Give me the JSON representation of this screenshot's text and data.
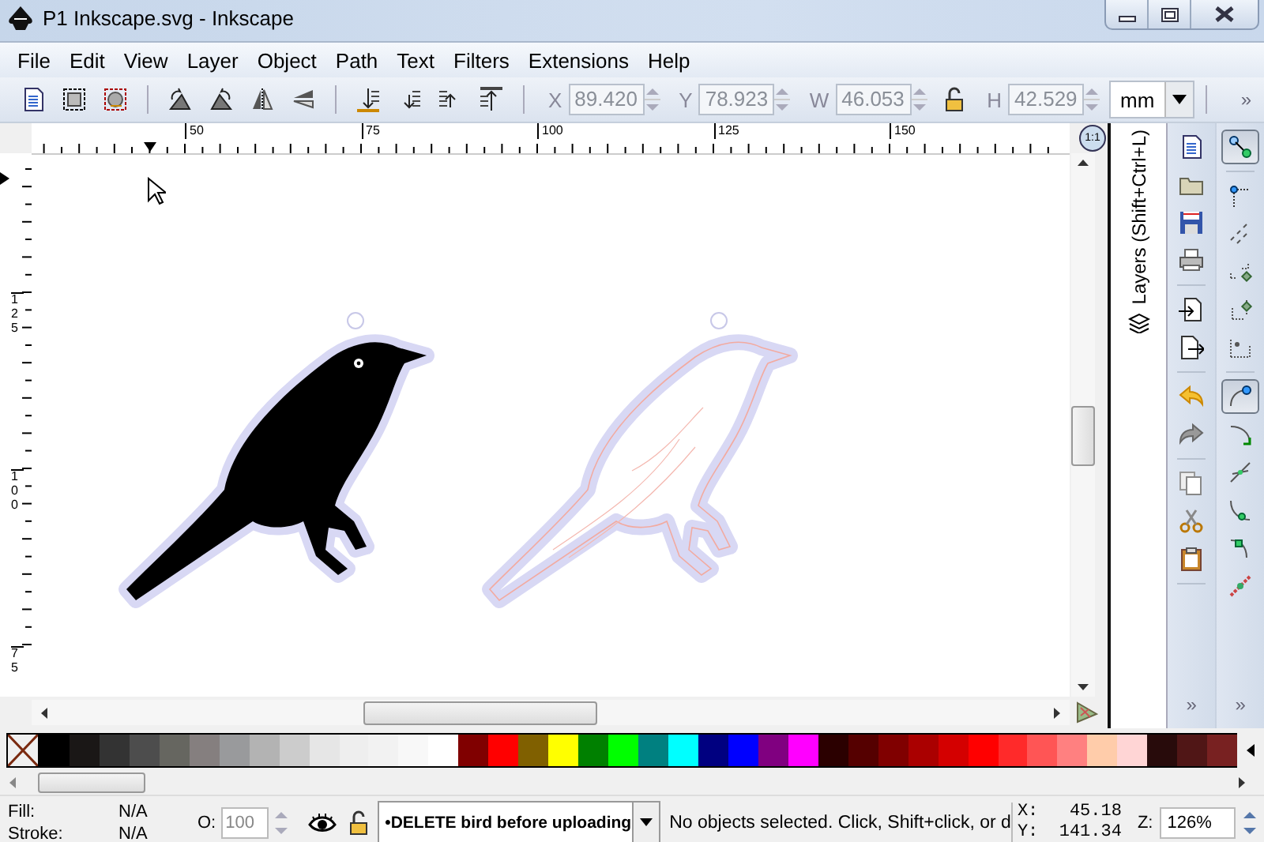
{
  "window": {
    "title": "P1 Inkscape.svg - Inkscape"
  },
  "menu": [
    "File",
    "Edit",
    "View",
    "Layer",
    "Object",
    "Path",
    "Text",
    "Filters",
    "Extensions",
    "Help"
  ],
  "toolbar": {
    "fields": [
      {
        "label": "X",
        "value": "89.420",
        "disabled": true
      },
      {
        "label": "Y",
        "value": "78.923",
        "disabled": true
      },
      {
        "label": "W",
        "value": "46.053",
        "disabled": true
      },
      {
        "label": "H",
        "value": "42.529",
        "disabled": true
      }
    ],
    "unit": "mm",
    "overflow": "»"
  },
  "rulers": {
    "horizontal": [
      "50",
      "75",
      "100",
      "125",
      "150"
    ],
    "vertical": [
      "125",
      "100",
      "75"
    ]
  },
  "canvas": {
    "zoom_button": "1:1"
  },
  "dock": {
    "tab": "Layers (Shift+Ctrl+L)"
  },
  "commands_bar": {
    "overflow": "»"
  },
  "snap_bar": {
    "overflow": "»",
    "buttons": [
      {
        "kind": "enable",
        "pressed": true
      },
      {
        "kind": "bbox",
        "pressed": false
      },
      {
        "kind": "bbox-edge",
        "pressed": false
      },
      {
        "kind": "bbox-corner",
        "pressed": false
      },
      {
        "kind": "bbox-midpoint",
        "pressed": false
      },
      {
        "kind": "bbox-center",
        "pressed": false
      },
      {
        "kind": "nodes",
        "pressed": true
      },
      {
        "kind": "path",
        "pressed": false
      },
      {
        "kind": "intersection",
        "pressed": false
      },
      {
        "kind": "smooth",
        "pressed": false
      },
      {
        "kind": "midpoint",
        "pressed": false
      },
      {
        "kind": "object-midpoint",
        "pressed": false
      }
    ]
  },
  "palette": [
    {
      "color": "#000000"
    },
    {
      "color": "#1a1716"
    },
    {
      "color": "#333333"
    },
    {
      "color": "#4d4d4d"
    },
    {
      "color": "#666660"
    },
    {
      "color": "#857f7f"
    },
    {
      "color": "#999a9c"
    },
    {
      "color": "#b3b3b3"
    },
    {
      "color": "#cccccc"
    },
    {
      "color": "#e6e6e6"
    },
    {
      "color": "#eeeeee"
    },
    {
      "color": "#f2f2f2"
    },
    {
      "color": "#f8f8f8"
    },
    {
      "color": "#ffffff"
    },
    {
      "color": "#800000"
    },
    {
      "color": "#ff0000"
    },
    {
      "color": "#806000"
    },
    {
      "color": "#ffff00"
    },
    {
      "color": "#008000"
    },
    {
      "color": "#00ff00"
    },
    {
      "color": "#008080"
    },
    {
      "color": "#00ffff"
    },
    {
      "color": "#000080"
    },
    {
      "color": "#0000ff"
    },
    {
      "color": "#800080"
    },
    {
      "color": "#ff00ff"
    },
    {
      "color": "#2b0000"
    },
    {
      "color": "#550000"
    },
    {
      "color": "#800000"
    },
    {
      "color": "#aa0000"
    },
    {
      "color": "#d40000"
    },
    {
      "color": "#ff0000"
    },
    {
      "color": "#ff2a2a"
    },
    {
      "color": "#ff5555"
    },
    {
      "color": "#ff8080"
    },
    {
      "color": "#ffccaa"
    },
    {
      "color": "#ffd5d5"
    },
    {
      "color": "#280b0b"
    },
    {
      "color": "#501616"
    },
    {
      "color": "#782121"
    }
  ],
  "status": {
    "fill_label": "Fill:",
    "fill_value": "N/A",
    "stroke_label": "Stroke:",
    "stroke_value": "N/A",
    "opacity_label": "O:",
    "opacity_value": "100",
    "layer": "•DELETE bird before uploading",
    "message": "No objects selected. Click, Shift+click, or d",
    "x_label": "X:",
    "x_value": "45.18",
    "y_label": "Y:",
    "y_value": "141.34",
    "zoom_label": "Z:",
    "zoom_value": "126%"
  }
}
